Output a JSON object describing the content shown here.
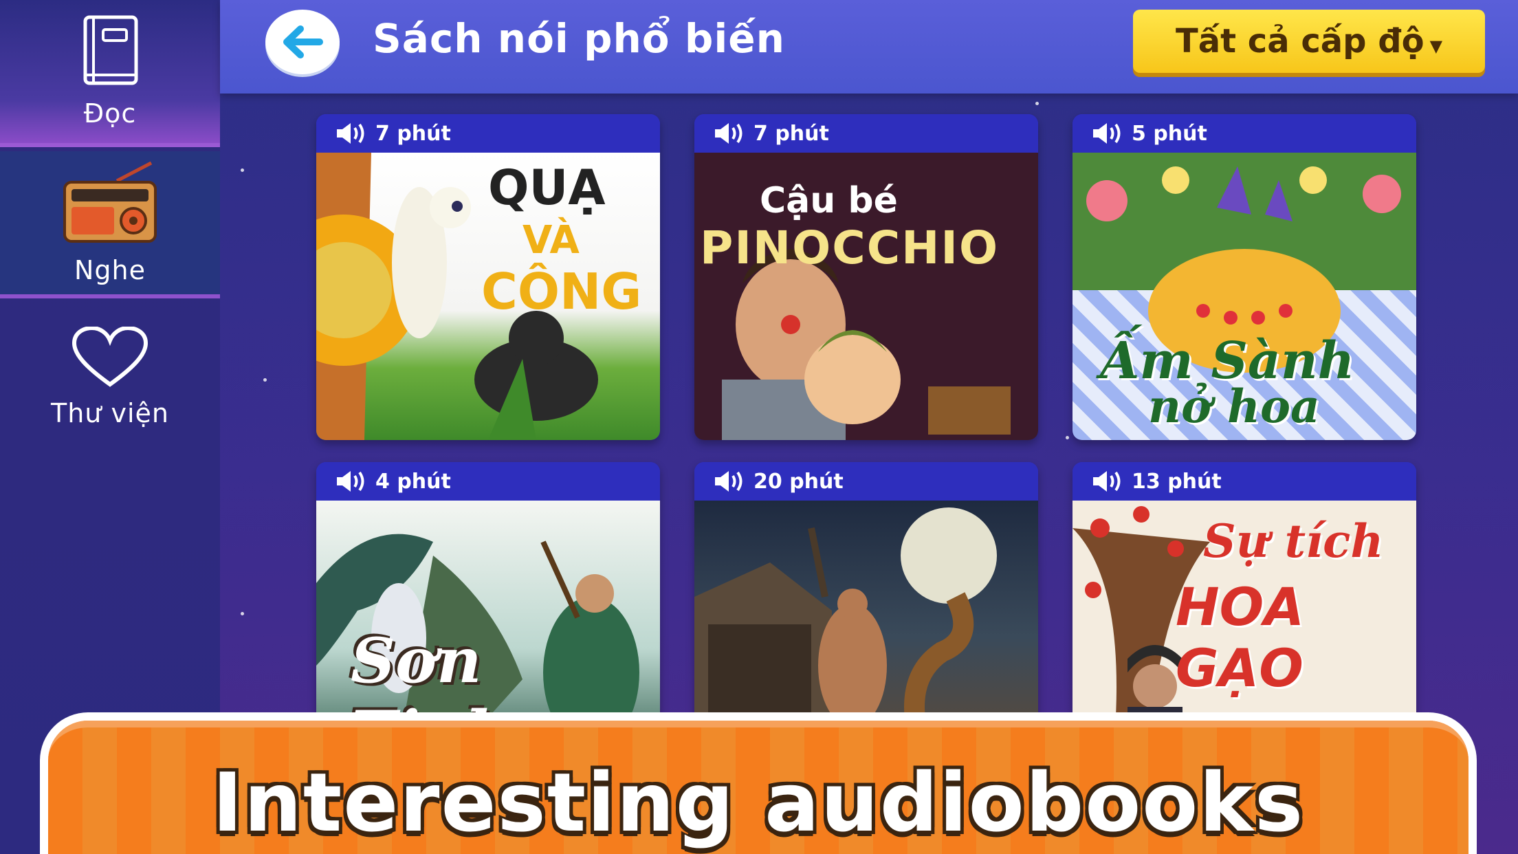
{
  "sidebar": {
    "items": [
      {
        "label": "Đọc",
        "icon": "book-icon"
      },
      {
        "label": "Nghe",
        "icon": "radio-icon"
      },
      {
        "label": "Thư viện",
        "icon": "heart-icon"
      }
    ]
  },
  "header": {
    "title": "Sách nói phổ biến",
    "level_filter": "Tất cả cấp độ"
  },
  "books": [
    {
      "duration": "7 phút",
      "cover_title_1": "QUẠ",
      "cover_title_2": "VÀ",
      "cover_title_3": "CÔNG"
    },
    {
      "duration": "7 phút",
      "cover_title_1": "Cậu bé",
      "cover_title_2": "PINOCCHIO"
    },
    {
      "duration": "5 phút",
      "cover_title_1": "Ấm Sành",
      "cover_title_2": "nở hoa"
    },
    {
      "duration": "4 phút",
      "cover_title_1": "Sơn Tinh"
    },
    {
      "duration": "20 phút",
      "cover_title_1": ""
    },
    {
      "duration": "13 phút",
      "cover_title_1": "Sự tích",
      "cover_title_2": "HOA GẠO"
    }
  ],
  "banner": {
    "text": "Interesting audiobooks"
  },
  "colors": {
    "accent_yellow": "#f7c61a",
    "header_blue": "#5a5fd9",
    "banner_orange": "#f57d1d"
  }
}
